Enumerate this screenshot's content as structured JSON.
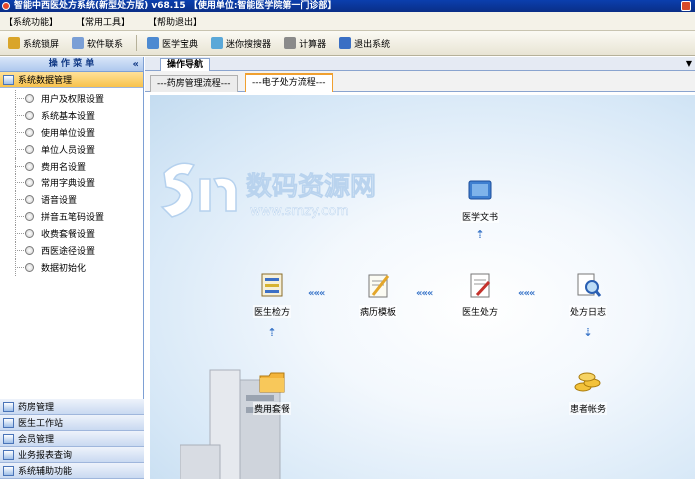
{
  "titlebar": {
    "title": "智能中西医处方系统(新型处方版) v68.15   【使用单位:智能医学院第一门诊部】"
  },
  "menu": [
    "【系统功能】",
    "【常用工具】",
    "【帮助退出】"
  ],
  "toolbar": [
    {
      "label": "系统锁屏",
      "icon": "lock-icon",
      "color": "#d9a52a"
    },
    {
      "label": "软件联系",
      "icon": "contact-icon",
      "color": "#7a9fd6"
    },
    {
      "label": "医学宝典",
      "icon": "book-icon",
      "color": "#4d8ad1"
    },
    {
      "label": "迷你搜搜器",
      "icon": "search-icon",
      "color": "#5aa8d8"
    },
    {
      "label": "计算器",
      "icon": "calculator-icon",
      "color": "#8a8a8a"
    },
    {
      "label": "退出系统",
      "icon": "exit-icon",
      "color": "#3a6fc4"
    }
  ],
  "sidebar": {
    "header": "操 作 菜 单",
    "collapse": "«",
    "active_group": "系统数据管理",
    "items": [
      "用户及权限设置",
      "系统基本设置",
      "使用单位设置",
      "单位人员设置",
      "费用名设置",
      "常用字典设置",
      "语音设置",
      "拼音五笔码设置",
      "收费套餐设置",
      "西医途径设置",
      "数据初始化"
    ],
    "groups": [
      "药房管理",
      "医生工作站",
      "会员管理",
      "业务报表查询",
      "系统辅助功能"
    ]
  },
  "main": {
    "nav_tab": "操作导航",
    "subtabs": [
      "---药房管理流程---",
      "---电子处方流程---"
    ],
    "selected_subtab": 1
  },
  "flow": {
    "watermark_main": "数码资源网",
    "watermark_sub": "www.smzy.com",
    "arrow_h": "«««",
    "arrow_v": "⇡",
    "nodes": {
      "medical_text": "医学文书",
      "doctor_checkup": "医生检方",
      "medical_record": "病历模板",
      "doctor_prescription": "医生处方",
      "prescription_log": "处方日志",
      "fee_package": "费用套餐",
      "patient_account": "患者帐务"
    }
  }
}
